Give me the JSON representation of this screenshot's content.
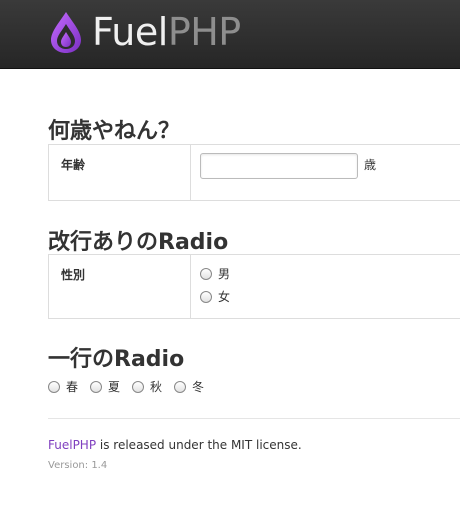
{
  "header": {
    "logo_fuel": "Fuel",
    "logo_php": "PHP",
    "accent_color": "#9b4fd6"
  },
  "section1": {
    "title": "何歳やねん？",
    "label": "年齢",
    "age_value": "",
    "suffix": "歳"
  },
  "section2": {
    "title": "改行ありのRadio",
    "label": "性別",
    "options": [
      "男",
      "女"
    ]
  },
  "section3": {
    "title": "一行のRadio",
    "options": [
      "春",
      "夏",
      "秋",
      "冬"
    ]
  },
  "footer": {
    "link": "FuelPHP",
    "text": " is released under the MIT license.",
    "version": "Version: 1.4"
  }
}
